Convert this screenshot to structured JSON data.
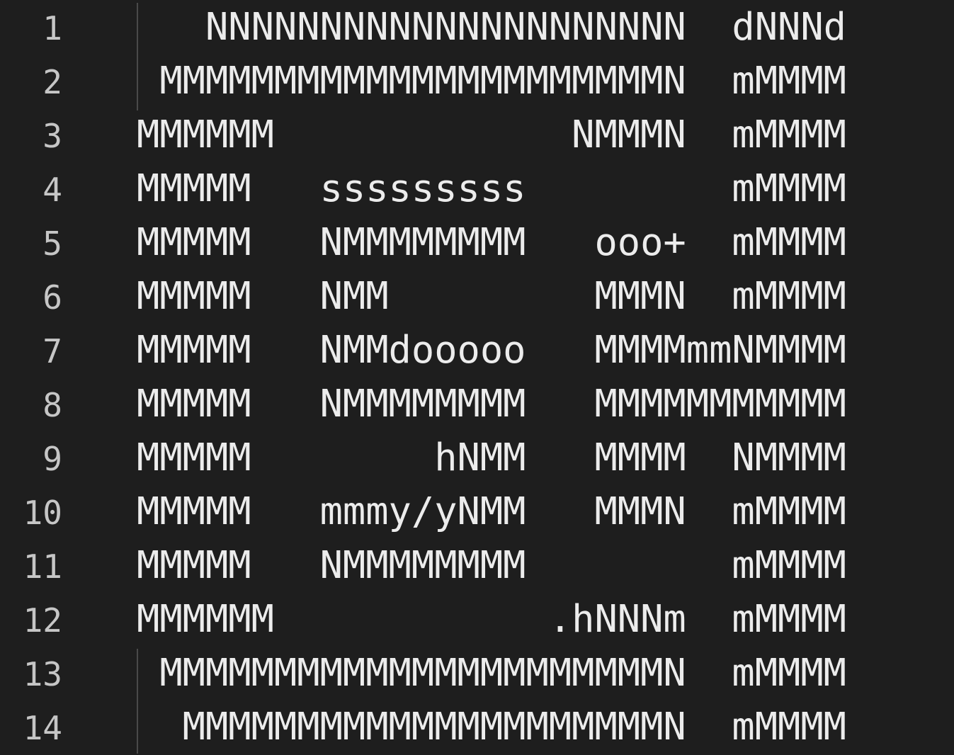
{
  "editor": {
    "lines": [
      {
        "number": "1",
        "text": "   NNNNNNNNNNNNNNNNNNNNN  dNNNd"
      },
      {
        "number": "2",
        "text": " MMMMMMMMMMMMMMMMMMMMMMN  mMMMM"
      },
      {
        "number": "3",
        "text": "MMMMMM             NMMMN  mMMMM"
      },
      {
        "number": "4",
        "text": "MMMMM   sssssssss         mMMMM"
      },
      {
        "number": "5",
        "text": "MMMMM   NMMMMMMMM   ooo+  mMMMM"
      },
      {
        "number": "6",
        "text": "MMMMM   NMM         MMMN  mMMMM"
      },
      {
        "number": "7",
        "text": "MMMMM   NMMdooooo   MMMMmmNMMMM"
      },
      {
        "number": "8",
        "text": "MMMMM   NMMMMMMMM   MMMMMMMMMMM"
      },
      {
        "number": "9",
        "text": "MMMMM        hNMM   MMMM  NMMMM"
      },
      {
        "number": "10",
        "text": "MMMMM   mmmy/yNMM   MMMN  mMMMM"
      },
      {
        "number": "11",
        "text": "MMMMM   NMMMMMMMM         mMMMM"
      },
      {
        "number": "12",
        "text": "MMMMMM            .hNNNm  mMMMM"
      },
      {
        "number": "13",
        "text": " MMMMMMMMMMMMMMMMMMMMMMN  mMMMM"
      },
      {
        "number": "14",
        "text": "  MMMMMMMMMMMMMMMMMMMMMN  mMMMM"
      }
    ]
  }
}
